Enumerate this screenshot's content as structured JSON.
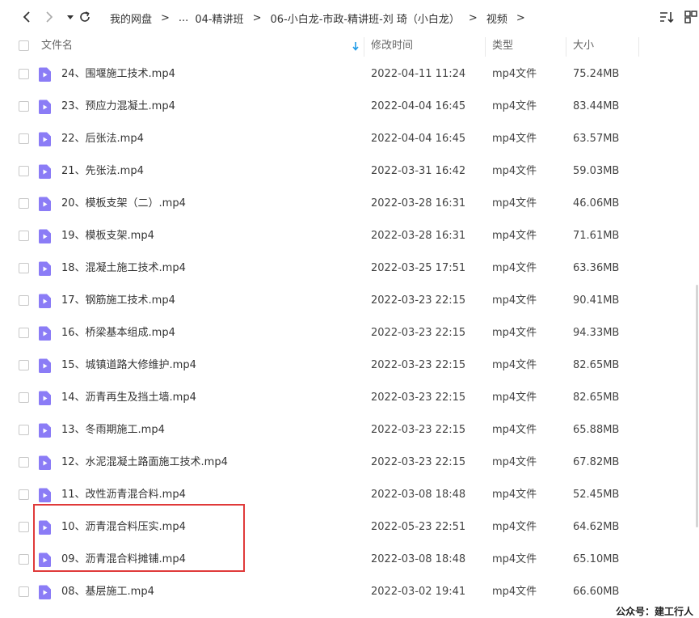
{
  "breadcrumb": {
    "items": [
      "我的网盘",
      "...",
      "04-精讲班",
      "06-小白龙-市政-精讲班-刘 琦（小白龙）",
      "视频"
    ],
    "separator": ">"
  },
  "columns": {
    "name": "文件名",
    "modified": "修改时间",
    "type": "类型",
    "size": "大小"
  },
  "files": [
    {
      "name": "24、围堰施工技术.mp4",
      "modified": "2022-04-11 11:24",
      "type": "mp4文件",
      "size": "75.24MB"
    },
    {
      "name": "23、预应力混凝土.mp4",
      "modified": "2022-04-04 16:45",
      "type": "mp4文件",
      "size": "83.44MB"
    },
    {
      "name": "22、后张法.mp4",
      "modified": "2022-04-04 16:45",
      "type": "mp4文件",
      "size": "63.57MB"
    },
    {
      "name": "21、先张法.mp4",
      "modified": "2022-03-31 16:42",
      "type": "mp4文件",
      "size": "59.03MB"
    },
    {
      "name": "20、模板支架（二）.mp4",
      "modified": "2022-03-28 16:31",
      "type": "mp4文件",
      "size": "46.06MB"
    },
    {
      "name": "19、模板支架.mp4",
      "modified": "2022-03-28 16:31",
      "type": "mp4文件",
      "size": "71.61MB"
    },
    {
      "name": "18、混凝土施工技术.mp4",
      "modified": "2022-03-25 17:51",
      "type": "mp4文件",
      "size": "63.36MB"
    },
    {
      "name": "17、钢筋施工技术.mp4",
      "modified": "2022-03-23 22:15",
      "type": "mp4文件",
      "size": "90.41MB"
    },
    {
      "name": "16、桥梁基本组成.mp4",
      "modified": "2022-03-23 22:15",
      "type": "mp4文件",
      "size": "94.33MB"
    },
    {
      "name": "15、城镇道路大修维护.mp4",
      "modified": "2022-03-23 22:15",
      "type": "mp4文件",
      "size": "82.65MB"
    },
    {
      "name": "14、沥青再生及挡土墙.mp4",
      "modified": "2022-03-23 22:15",
      "type": "mp4文件",
      "size": "82.65MB"
    },
    {
      "name": "13、冬雨期施工.mp4",
      "modified": "2022-03-23 22:15",
      "type": "mp4文件",
      "size": "65.88MB"
    },
    {
      "name": "12、水泥混凝土路面施工技术.mp4",
      "modified": "2022-03-23 22:15",
      "type": "mp4文件",
      "size": "67.82MB"
    },
    {
      "name": "11、改性沥青混合料.mp4",
      "modified": "2022-03-08 18:48",
      "type": "mp4文件",
      "size": "52.45MB"
    },
    {
      "name": "10、沥青混合料压实.mp4",
      "modified": "2022-05-23 22:51",
      "type": "mp4文件",
      "size": "64.62MB"
    },
    {
      "name": "09、沥青混合料摊铺.mp4",
      "modified": "2022-03-08 18:48",
      "type": "mp4文件",
      "size": "65.10MB"
    },
    {
      "name": "08、基层施工.mp4",
      "modified": "2022-03-02 19:41",
      "type": "mp4文件",
      "size": "66.60MB"
    }
  ],
  "watermark": "公众号：建工行人",
  "colors": {
    "file_icon": "#8b7cf6",
    "highlight_border": "#e03a3a",
    "sort_accent": "#1e9be8"
  }
}
